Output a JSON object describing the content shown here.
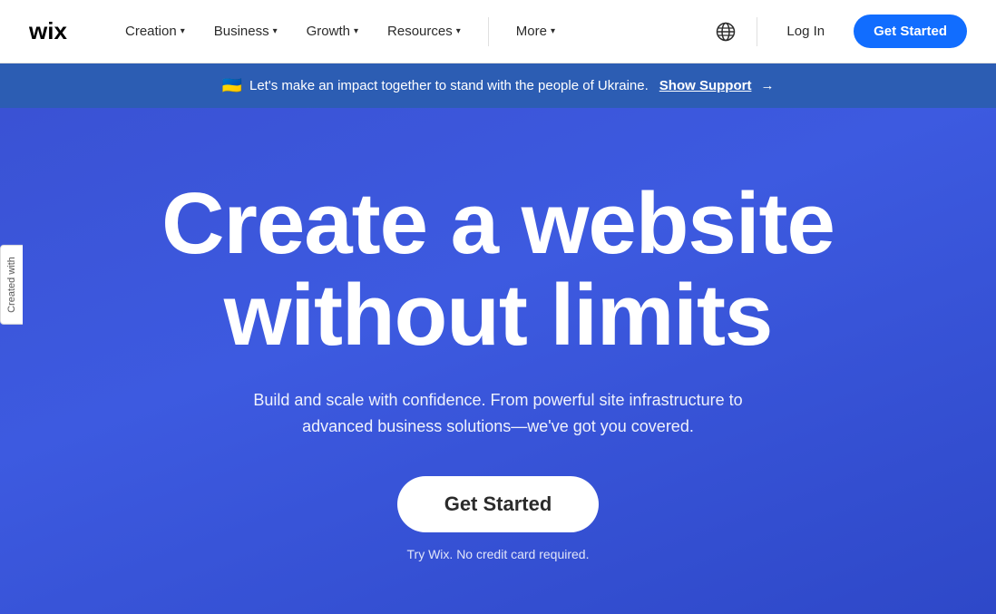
{
  "navbar": {
    "logo_text": "wix",
    "nav_items": [
      {
        "id": "creation",
        "label": "Creation",
        "has_dropdown": true
      },
      {
        "id": "business",
        "label": "Business",
        "has_dropdown": true
      },
      {
        "id": "growth",
        "label": "Growth",
        "has_dropdown": true
      },
      {
        "id": "resources",
        "label": "Resources",
        "has_dropdown": true
      },
      {
        "id": "more",
        "label": "More",
        "has_dropdown": true
      }
    ],
    "login_label": "Log In",
    "get_started_label": "Get Started"
  },
  "banner": {
    "flag_emoji": "🇺🇦",
    "text": "Let's make an impact together to stand with the people of Ukraine.",
    "cta_text": "Show Support",
    "arrow": "→"
  },
  "hero": {
    "title_line1": "Create a website",
    "title_line2": "without limits",
    "subtitle": "Build and scale with confidence. From powerful site infrastructure to advanced business solutions—we've got you covered.",
    "cta_button": "Get Started",
    "disclaimer": "Try Wix. No credit card required."
  },
  "side_tab": {
    "text": "Created with"
  },
  "colors": {
    "nav_bg": "#ffffff",
    "banner_bg": "#2c5db3",
    "hero_bg": "#3d54cf",
    "cta_btn_bg": "#116dff",
    "hero_cta_bg": "#ffffff"
  }
}
